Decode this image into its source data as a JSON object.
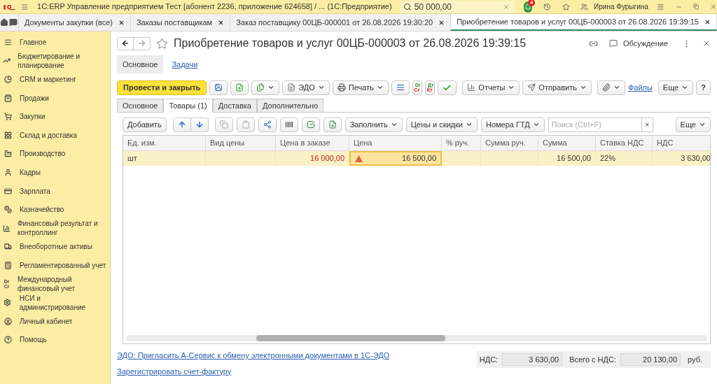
{
  "app_bar": {
    "app_title": "1С:ERP Управление предприятием Тест [абонент 2236, приложение 624658] / ...  (1С:Предприятие)",
    "search_value": "50 000,00",
    "notification_count": "4",
    "user": "Ирина Фурыгина"
  },
  "open_tabs": [
    {
      "label": "Документы закупки (все)",
      "selected": false
    },
    {
      "label": "Заказы поставщикам",
      "selected": false
    },
    {
      "label": "Заказ поставщику 00ЦБ-000001 от 26.08.2026 19:30:20",
      "selected": false
    },
    {
      "label": "Приобретение товаров и услуг 00ЦБ-000003 от 26.08.2026 19:39:15",
      "selected": true
    }
  ],
  "sidebar": {
    "items": [
      {
        "label": "Главное"
      },
      {
        "label": "Бюджетирование и планирование"
      },
      {
        "label": "CRM и маркетинг"
      },
      {
        "label": "Продажи"
      },
      {
        "label": "Закупки"
      },
      {
        "label": "Склад и доставка"
      },
      {
        "label": "Производство"
      },
      {
        "label": "Кадры"
      },
      {
        "label": "Зарплата"
      },
      {
        "label": "Казначейство"
      },
      {
        "label": "Финансовый результат и контроллинг"
      },
      {
        "label": "Внеоборотные активы"
      },
      {
        "label": "Регламентированный учет"
      },
      {
        "label": "Международный финансовый учет",
        "icon_text": [
          "Dr",
          "Cr"
        ]
      },
      {
        "label": "НСИ и администрирование"
      },
      {
        "label": "Личный кабинет"
      },
      {
        "label": "Помощь"
      }
    ]
  },
  "form": {
    "title": "Приобретение товаров и услуг 00ЦБ-000003 от 26.08.2026 19:39:15",
    "discussion": "Обсуждение",
    "nav": [
      {
        "label": "Основное",
        "selected": true
      },
      {
        "label": "Задачи",
        "selected": false
      }
    ],
    "toolbar": {
      "post_close": "Провести и закрыть",
      "edo": "ЭДО",
      "print": "Печать",
      "dr_cr": [
        "Dr",
        "Cr"
      ],
      "dt_kt": [
        "Дт",
        "Кт"
      ],
      "reports": "Отчеты",
      "send": "Отправить",
      "files": "Файлы",
      "more": "Еще",
      "help": "?"
    },
    "tabs": [
      {
        "label": "Основное",
        "selected": false
      },
      {
        "label": "Товары (1)",
        "selected": true
      },
      {
        "label": "Доставка",
        "selected": false
      },
      {
        "label": "Дополнительно",
        "selected": false
      }
    ],
    "table_toolbar": {
      "add": "Добавить",
      "fill": "Заполнить",
      "prices": "Цены и скидки",
      "gtd": "Номера ГТД",
      "search_placeholder": "Поиск (Ctrl+F)",
      "clear": "×",
      "more": "Еще"
    },
    "table": {
      "columns": [
        "Ед. изм.",
        "Вид цены",
        "Цена в заказе",
        "Цена",
        "% руч.",
        "Сумма руч.",
        "Сумма",
        "Ставка НДС",
        "НДС"
      ],
      "rows": [
        {
          "selected": true,
          "cells": [
            "шт",
            "",
            "16 000,00",
            "16 500,00",
            "",
            "",
            "16 500,00",
            "22%",
            "3 630,00"
          ],
          "warning": true
        }
      ]
    },
    "links": [
      "ЭДО: Пригласить А-Сервис к обмену электронными документами в 1С-ЭДО",
      "Зарегистрировать счет-фактуру"
    ],
    "totals": {
      "vat_label": "НДС:",
      "vat": "3 630,00",
      "total_label": "Всего с НДС:",
      "total": "20 130,00",
      "currency": "руб."
    }
  }
}
